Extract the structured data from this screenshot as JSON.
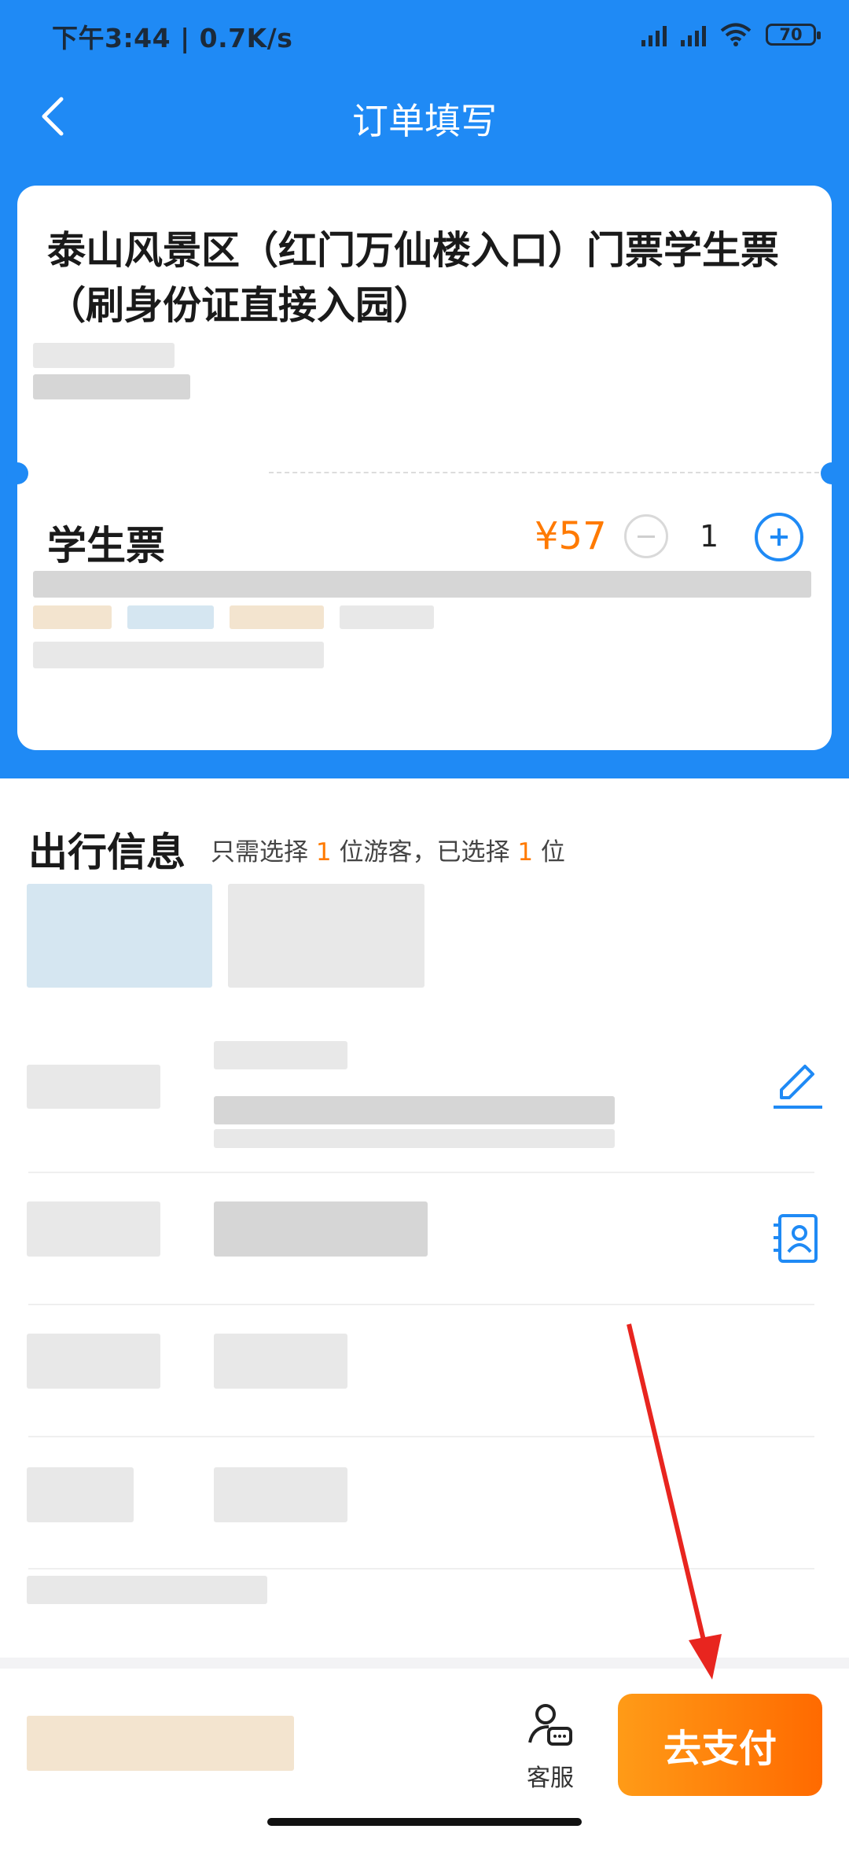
{
  "status_bar": {
    "time_speed": "下午3:44 | 0.7K/s",
    "battery": "70"
  },
  "nav": {
    "title": "订单填写"
  },
  "ticket": {
    "title": "泰山风景区（红门万仙楼入口）门票学生票（刷身份证直接入园）",
    "type_label": "学生票",
    "price": "¥57",
    "quantity": "1"
  },
  "travel": {
    "title": "出行信息",
    "hint_prefix": "只需选择 ",
    "hint_required": "1",
    "hint_middle": " 位游客，已选择 ",
    "hint_selected": "1",
    "hint_suffix": " 位"
  },
  "bottom": {
    "service_label": "客服",
    "pay_label": "去支付"
  },
  "colors": {
    "brand_blue": "#1f8af5",
    "accent_orange": "#ff7a00",
    "annotation_red": "#e8251f"
  }
}
